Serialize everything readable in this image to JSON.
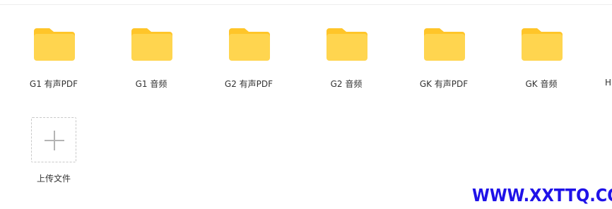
{
  "folders": [
    {
      "label": "G1 有声PDF"
    },
    {
      "label": "G1 音频"
    },
    {
      "label": "G2 有声PDF"
    },
    {
      "label": "G2 音频"
    },
    {
      "label": "GK 有声PDF"
    },
    {
      "label": "GK 音频"
    },
    {
      "label": "H"
    }
  ],
  "upload": {
    "label": "上传文件",
    "icon": "plus-icon"
  },
  "folder_icon": "folder-icon",
  "watermark": {
    "text": "WWW.XXTTQ.COM"
  },
  "colors": {
    "folder_front": "#FFD54F",
    "folder_back": "#FFC529",
    "watermark": "#1F12E8"
  }
}
